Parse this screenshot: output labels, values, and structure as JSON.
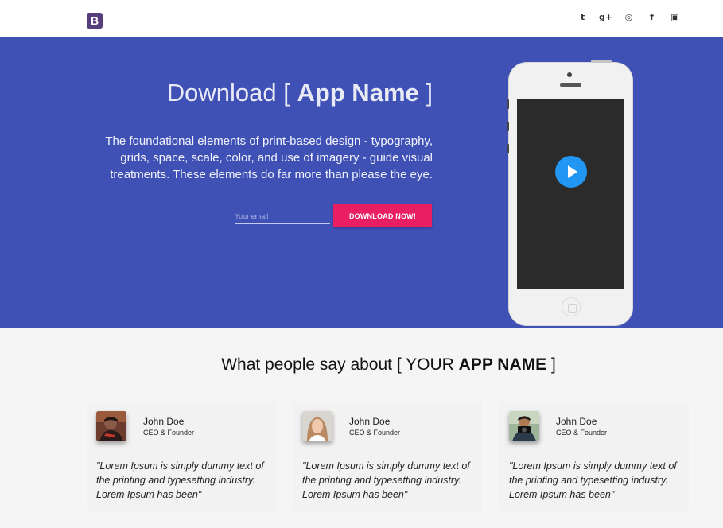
{
  "brand": {
    "logo_letter": "B"
  },
  "social": [
    {
      "icon": "twitter-icon",
      "glyph": "t"
    },
    {
      "icon": "google-plus-icon",
      "glyph": "g+"
    },
    {
      "icon": "dribbble-icon",
      "glyph": "◎"
    },
    {
      "icon": "facebook-icon",
      "glyph": "f"
    },
    {
      "icon": "youtube-icon",
      "glyph": "▣"
    }
  ],
  "hero": {
    "title_prefix": "Download [",
    "title_app": "App Name",
    "title_suffix": "]",
    "description": "The foundational elements of print-based design - typography, grids, space, scale, color, and use of imagery - guide visual treatments. These elements do far more than please the eye.",
    "email_placeholder": "Your email",
    "download_label": "DOWNLOAD NOW!",
    "background": "#3f51b5",
    "button_color": "#e91e63",
    "play_color": "#2196f3"
  },
  "testimonials": {
    "title_prefix": "What people say about [ YOUR",
    "title_app": "APP NAME",
    "title_suffix": "]",
    "items": [
      {
        "name": "John Doe",
        "role": "CEO & Founder",
        "quote": "\"Lorem Ipsum is simply dummy text of the printing and typesetting industry. Lorem Ipsum has been\""
      },
      {
        "name": "John Doe",
        "role": "CEO & Founder",
        "quote": "\"Lorem Ipsum is simply dummy text of the printing and typesetting industry. Lorem Ipsum has been\""
      },
      {
        "name": "John Doe",
        "role": "CEO & Founder",
        "quote": "\"Lorem Ipsum is simply dummy text of the printing and typesetting industry. Lorem Ipsum has been\""
      }
    ]
  }
}
